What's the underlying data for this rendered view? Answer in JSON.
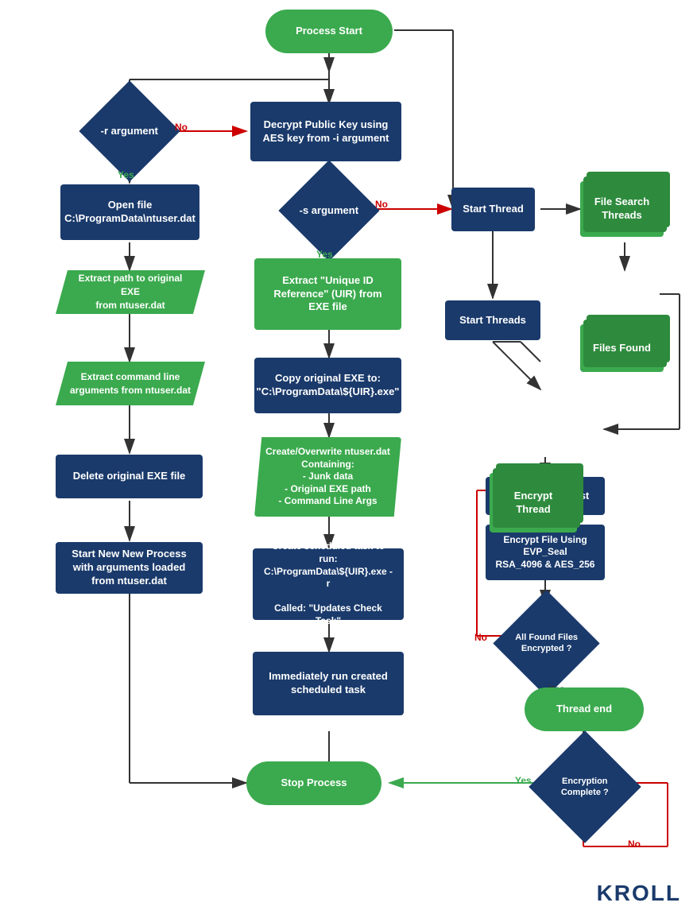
{
  "nodes": {
    "process_start": "Process Start",
    "r_argument": "-r argument",
    "decrypt_public_key": "Decrypt Public Key using\nAES key from -i argument",
    "open_file": "Open file\nC:\\ProgramData\\ntuser.dat",
    "s_argument": "-s argument",
    "extract_path": "Extract path to original EXE\nfrom ntuser.dat",
    "extract_uid": "Extract \"Unique ID\nReference\" (UIR) from\nEXE file",
    "extract_cmdline": "Extract command line\narguments from ntuser.dat",
    "copy_exe": "Copy original EXE to:\n\"C:\\ProgramData\\${UIR}.exe\"",
    "delete_exe": "Delete original EXE file",
    "create_overwrite": "Create/Overwrite ntuser.dat\nContaining:\n - Junk data\n - Original EXE path\n - Command Line Args",
    "start_new_process": "Start New New Process\nwith arguments loaded\nfrom ntuser.dat",
    "create_scheduled": "Create scheduled task to run:\nC:\\ProgramData\\${UIR}.exe -r\n\nCalled: \"Updates Check Task\"",
    "immediately_run": "Immediately run created\nscheduled task",
    "stop_process": "Stop Process",
    "start_thread": "Start Thread",
    "file_search_threads": "File Search\nThreads",
    "files_found": "Files Found",
    "start_threads": "Start Threads",
    "encrypt_thread": "Encrypt\nThread",
    "get_file": "Get File From List",
    "encrypt_file": "Encrypt File Using\nEVP_Seal\nRSA_4096 & AES_256",
    "all_found": "All\nFound Files\nEncrypted ?",
    "thread_end": "Thread end",
    "encryption_complete": "Encryption\nComplete ?",
    "no_label": "No",
    "yes_label": "Yes"
  },
  "colors": {
    "green": "#3baa4e",
    "blue": "#1a3a6b",
    "arrow": "#333",
    "arrow_red": "#cc0000",
    "background": "#ffffff"
  }
}
